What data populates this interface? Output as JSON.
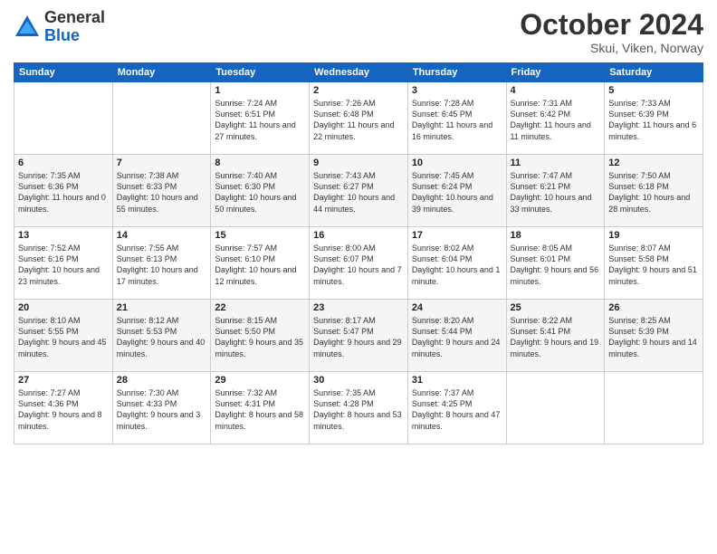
{
  "logo": {
    "general": "General",
    "blue": "Blue"
  },
  "header": {
    "month": "October 2024",
    "location": "Skui, Viken, Norway"
  },
  "weekdays": [
    "Sunday",
    "Monday",
    "Tuesday",
    "Wednesday",
    "Thursday",
    "Friday",
    "Saturday"
  ],
  "weeks": [
    [
      {
        "day": "",
        "sunrise": "",
        "sunset": "",
        "daylight": ""
      },
      {
        "day": "",
        "sunrise": "",
        "sunset": "",
        "daylight": ""
      },
      {
        "day": "1",
        "sunrise": "Sunrise: 7:24 AM",
        "sunset": "Sunset: 6:51 PM",
        "daylight": "Daylight: 11 hours and 27 minutes."
      },
      {
        "day": "2",
        "sunrise": "Sunrise: 7:26 AM",
        "sunset": "Sunset: 6:48 PM",
        "daylight": "Daylight: 11 hours and 22 minutes."
      },
      {
        "day": "3",
        "sunrise": "Sunrise: 7:28 AM",
        "sunset": "Sunset: 6:45 PM",
        "daylight": "Daylight: 11 hours and 16 minutes."
      },
      {
        "day": "4",
        "sunrise": "Sunrise: 7:31 AM",
        "sunset": "Sunset: 6:42 PM",
        "daylight": "Daylight: 11 hours and 11 minutes."
      },
      {
        "day": "5",
        "sunrise": "Sunrise: 7:33 AM",
        "sunset": "Sunset: 6:39 PM",
        "daylight": "Daylight: 11 hours and 6 minutes."
      }
    ],
    [
      {
        "day": "6",
        "sunrise": "Sunrise: 7:35 AM",
        "sunset": "Sunset: 6:36 PM",
        "daylight": "Daylight: 11 hours and 0 minutes."
      },
      {
        "day": "7",
        "sunrise": "Sunrise: 7:38 AM",
        "sunset": "Sunset: 6:33 PM",
        "daylight": "Daylight: 10 hours and 55 minutes."
      },
      {
        "day": "8",
        "sunrise": "Sunrise: 7:40 AM",
        "sunset": "Sunset: 6:30 PM",
        "daylight": "Daylight: 10 hours and 50 minutes."
      },
      {
        "day": "9",
        "sunrise": "Sunrise: 7:43 AM",
        "sunset": "Sunset: 6:27 PM",
        "daylight": "Daylight: 10 hours and 44 minutes."
      },
      {
        "day": "10",
        "sunrise": "Sunrise: 7:45 AM",
        "sunset": "Sunset: 6:24 PM",
        "daylight": "Daylight: 10 hours and 39 minutes."
      },
      {
        "day": "11",
        "sunrise": "Sunrise: 7:47 AM",
        "sunset": "Sunset: 6:21 PM",
        "daylight": "Daylight: 10 hours and 33 minutes."
      },
      {
        "day": "12",
        "sunrise": "Sunrise: 7:50 AM",
        "sunset": "Sunset: 6:18 PM",
        "daylight": "Daylight: 10 hours and 28 minutes."
      }
    ],
    [
      {
        "day": "13",
        "sunrise": "Sunrise: 7:52 AM",
        "sunset": "Sunset: 6:16 PM",
        "daylight": "Daylight: 10 hours and 23 minutes."
      },
      {
        "day": "14",
        "sunrise": "Sunrise: 7:55 AM",
        "sunset": "Sunset: 6:13 PM",
        "daylight": "Daylight: 10 hours and 17 minutes."
      },
      {
        "day": "15",
        "sunrise": "Sunrise: 7:57 AM",
        "sunset": "Sunset: 6:10 PM",
        "daylight": "Daylight: 10 hours and 12 minutes."
      },
      {
        "day": "16",
        "sunrise": "Sunrise: 8:00 AM",
        "sunset": "Sunset: 6:07 PM",
        "daylight": "Daylight: 10 hours and 7 minutes."
      },
      {
        "day": "17",
        "sunrise": "Sunrise: 8:02 AM",
        "sunset": "Sunset: 6:04 PM",
        "daylight": "Daylight: 10 hours and 1 minute."
      },
      {
        "day": "18",
        "sunrise": "Sunrise: 8:05 AM",
        "sunset": "Sunset: 6:01 PM",
        "daylight": "Daylight: 9 hours and 56 minutes."
      },
      {
        "day": "19",
        "sunrise": "Sunrise: 8:07 AM",
        "sunset": "Sunset: 5:58 PM",
        "daylight": "Daylight: 9 hours and 51 minutes."
      }
    ],
    [
      {
        "day": "20",
        "sunrise": "Sunrise: 8:10 AM",
        "sunset": "Sunset: 5:55 PM",
        "daylight": "Daylight: 9 hours and 45 minutes."
      },
      {
        "day": "21",
        "sunrise": "Sunrise: 8:12 AM",
        "sunset": "Sunset: 5:53 PM",
        "daylight": "Daylight: 9 hours and 40 minutes."
      },
      {
        "day": "22",
        "sunrise": "Sunrise: 8:15 AM",
        "sunset": "Sunset: 5:50 PM",
        "daylight": "Daylight: 9 hours and 35 minutes."
      },
      {
        "day": "23",
        "sunrise": "Sunrise: 8:17 AM",
        "sunset": "Sunset: 5:47 PM",
        "daylight": "Daylight: 9 hours and 29 minutes."
      },
      {
        "day": "24",
        "sunrise": "Sunrise: 8:20 AM",
        "sunset": "Sunset: 5:44 PM",
        "daylight": "Daylight: 9 hours and 24 minutes."
      },
      {
        "day": "25",
        "sunrise": "Sunrise: 8:22 AM",
        "sunset": "Sunset: 5:41 PM",
        "daylight": "Daylight: 9 hours and 19 minutes."
      },
      {
        "day": "26",
        "sunrise": "Sunrise: 8:25 AM",
        "sunset": "Sunset: 5:39 PM",
        "daylight": "Daylight: 9 hours and 14 minutes."
      }
    ],
    [
      {
        "day": "27",
        "sunrise": "Sunrise: 7:27 AM",
        "sunset": "Sunset: 4:36 PM",
        "daylight": "Daylight: 9 hours and 8 minutes."
      },
      {
        "day": "28",
        "sunrise": "Sunrise: 7:30 AM",
        "sunset": "Sunset: 4:33 PM",
        "daylight": "Daylight: 9 hours and 3 minutes."
      },
      {
        "day": "29",
        "sunrise": "Sunrise: 7:32 AM",
        "sunset": "Sunset: 4:31 PM",
        "daylight": "Daylight: 8 hours and 58 minutes."
      },
      {
        "day": "30",
        "sunrise": "Sunrise: 7:35 AM",
        "sunset": "Sunset: 4:28 PM",
        "daylight": "Daylight: 8 hours and 53 minutes."
      },
      {
        "day": "31",
        "sunrise": "Sunrise: 7:37 AM",
        "sunset": "Sunset: 4:25 PM",
        "daylight": "Daylight: 8 hours and 47 minutes."
      },
      {
        "day": "",
        "sunrise": "",
        "sunset": "",
        "daylight": ""
      },
      {
        "day": "",
        "sunrise": "",
        "sunset": "",
        "daylight": ""
      }
    ]
  ]
}
